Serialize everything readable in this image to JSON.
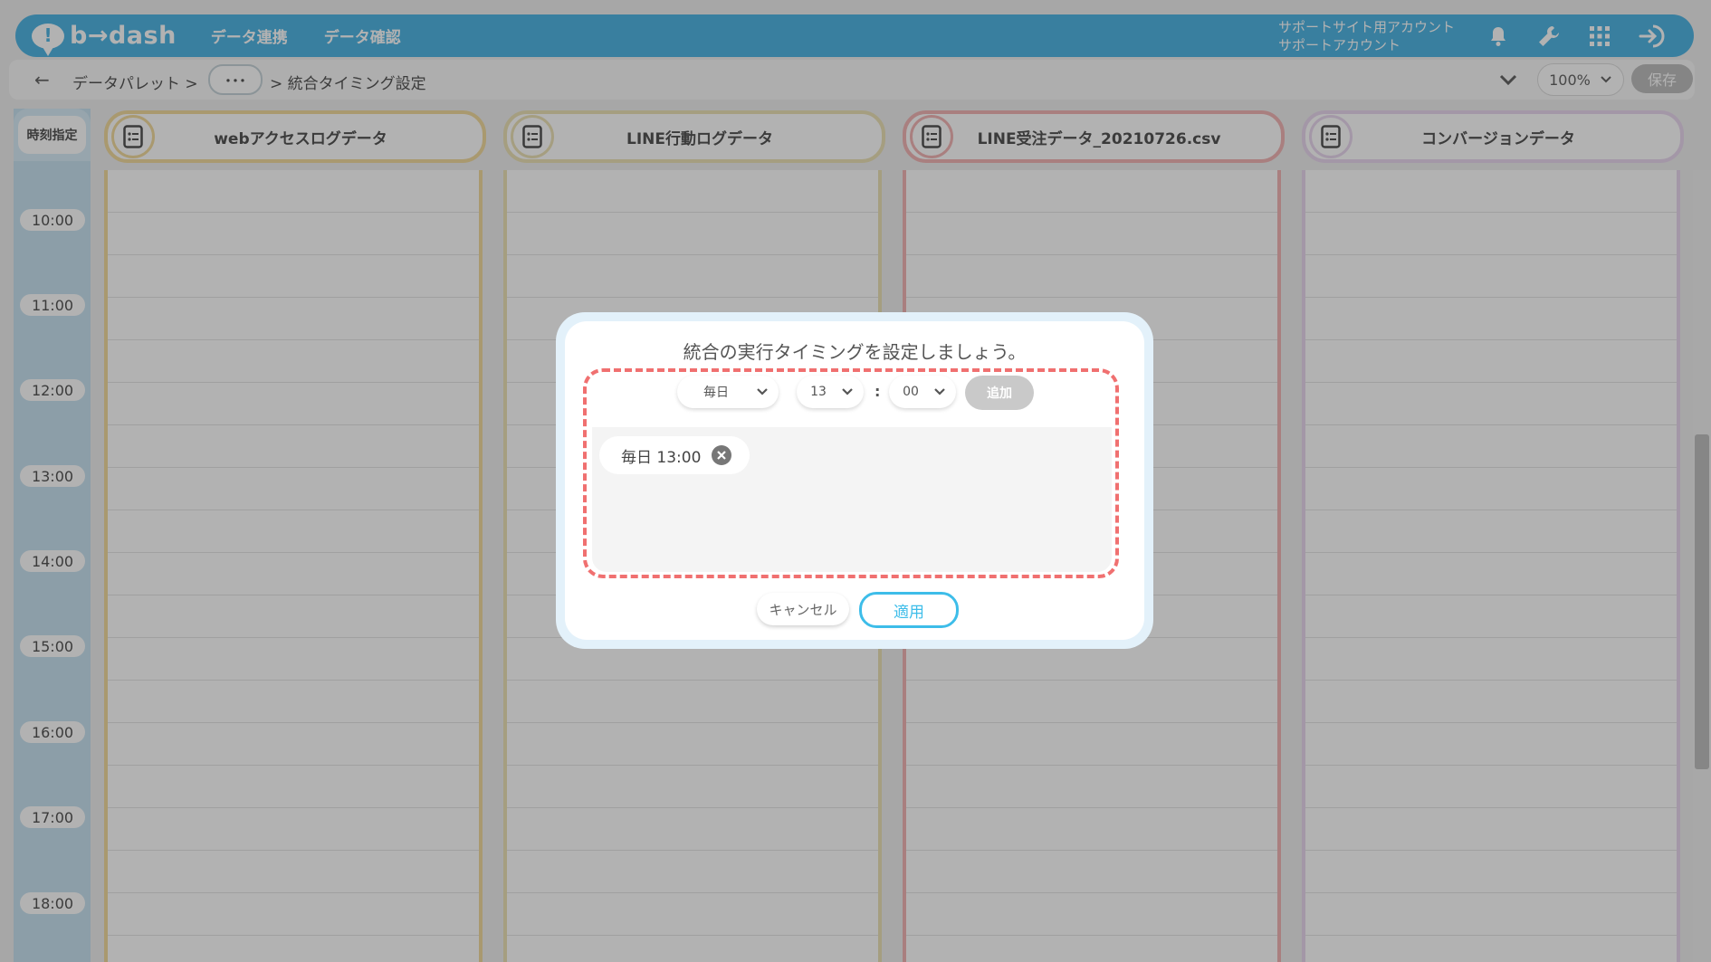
{
  "app": {
    "logo_text": "b→dash"
  },
  "nav": [
    {
      "label": "データ連携"
    },
    {
      "label": "データ確認"
    }
  ],
  "account": {
    "line1": "サポートサイト用アカウント",
    "line2": "サポートアカウント"
  },
  "breadcrumb": {
    "root": "データパレット >",
    "ellipsis": "･･･",
    "current": "> 統合タイミング設定"
  },
  "toolbar": {
    "zoom": "100%",
    "save_label": "保存"
  },
  "calendar": {
    "time_header": "時刻指定",
    "times": [
      "10:00",
      "11:00",
      "12:00",
      "13:00",
      "14:00",
      "15:00",
      "16:00",
      "17:00",
      "18:00"
    ],
    "columns": [
      {
        "title": "webアクセスログデータ",
        "color": "#f3dba0"
      },
      {
        "title": "LINE行動ログデータ",
        "color": "#ede2b8"
      },
      {
        "title": "LINE受注データ_20210726.csv",
        "color": "#f2b6b6"
      },
      {
        "title": "コンバージョンデータ",
        "color": "#ead8f0"
      }
    ]
  },
  "modal": {
    "title": "統合の実行タイミングを設定しましょう。",
    "frequency": "毎日",
    "hour": "13",
    "colon": ":",
    "minute": "00",
    "add_label": "追加",
    "entries": [
      {
        "label": "毎日 13:00"
      }
    ],
    "cancel_label": "キャンセル",
    "apply_label": "適用"
  },
  "colors": {
    "brand": "#52b6e4",
    "accent": "#3dbde9",
    "dash": "#f07070"
  }
}
